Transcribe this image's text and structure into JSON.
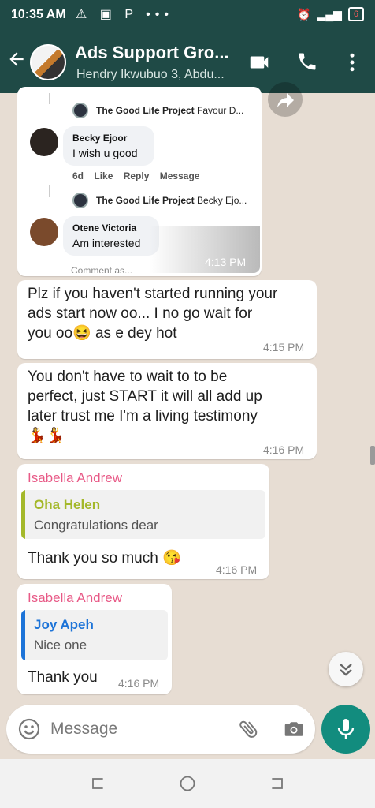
{
  "status_bar": {
    "time": "10:35 AM",
    "left_icons": "⚠ ▣ P •••",
    "battery": "6"
  },
  "header": {
    "title": "Ads Support Gro...",
    "subtitle": "Hendry Ikwubuo 3, Abdu..."
  },
  "screenshot_post": {
    "row1": {
      "page": "The Good Life Project",
      "rest": "Favour D..."
    },
    "comment1": {
      "name": "Becky Ejoor",
      "text": "I wish u good"
    },
    "actions": {
      "age": "6d",
      "like": "Like",
      "reply": "Reply",
      "message": "Message"
    },
    "row2": {
      "page": "The Good Life Project",
      "rest": "Becky Ejo..."
    },
    "comment2": {
      "name": "Otene Victoria",
      "text": "Am interested"
    },
    "footer": "Comment as..."
  },
  "messages": [
    {
      "time": "4:13 PM"
    },
    {
      "text_lines": [
        "Plz if you haven't started running your",
        "ads start now oo... I no go wait for",
        "you oo😆 as e dey hot"
      ],
      "time": "4:15 PM"
    },
    {
      "text_lines": [
        "You don't have to wait to to be",
        "perfect, just START  it will all add up",
        "later trust me I'm a living testimony",
        "💃💃"
      ],
      "time": "4:16 PM"
    },
    {
      "sender": "Isabella Andrew",
      "quote_name": "Oha Helen",
      "quote_text": "Congratulations dear",
      "text": "Thank you so much 😘",
      "time": "4:16 PM"
    },
    {
      "sender": "Isabella Andrew",
      "quote_name": "Joy Apeh",
      "quote_text": "Nice one",
      "text": "Thank you",
      "time": "4:16 PM"
    }
  ],
  "input": {
    "placeholder": "Message"
  },
  "colors": {
    "header": "#1f4a46",
    "sender": "#e85a87",
    "quote_green": "#a4b82a",
    "quote_blue": "#1d74d8",
    "mic": "#128c7e"
  }
}
